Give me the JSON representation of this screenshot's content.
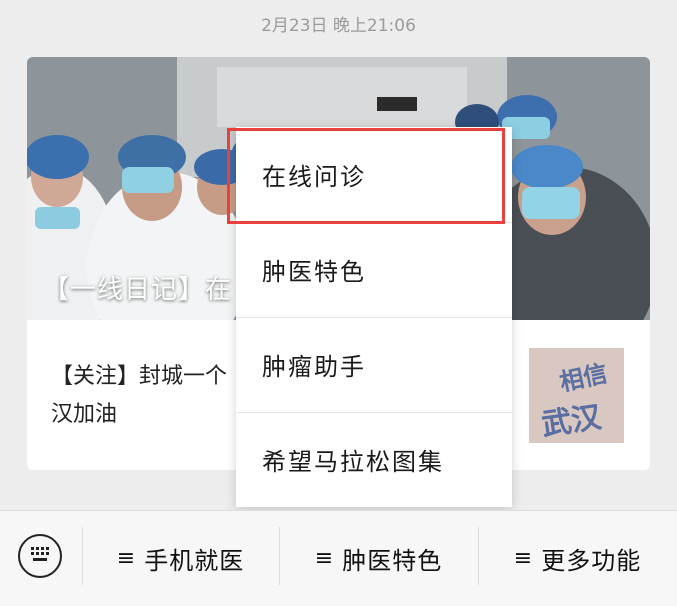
{
  "timestamp": "2月23日 晚上21:06",
  "card": {
    "hero_title": "【一线日记】在",
    "article_text": "【关注】封城一个汉加油",
    "article_line1": "【关注】封城一个",
    "article_line2": "汉加油",
    "thumb_text_1": "相信",
    "thumb_text_2": "武汉"
  },
  "menu": {
    "items": [
      {
        "label": "在线问诊"
      },
      {
        "label": "肿医特色"
      },
      {
        "label": "肿瘤助手"
      },
      {
        "label": "希望马拉松图集"
      }
    ]
  },
  "bottom_bar": {
    "tabs": [
      {
        "label": "手机就医"
      },
      {
        "label": "肿医特色"
      },
      {
        "label": "更多功能"
      }
    ],
    "menu_glyph": "≡"
  },
  "colors": {
    "highlight": "#e8403c",
    "background": "#ededed"
  }
}
